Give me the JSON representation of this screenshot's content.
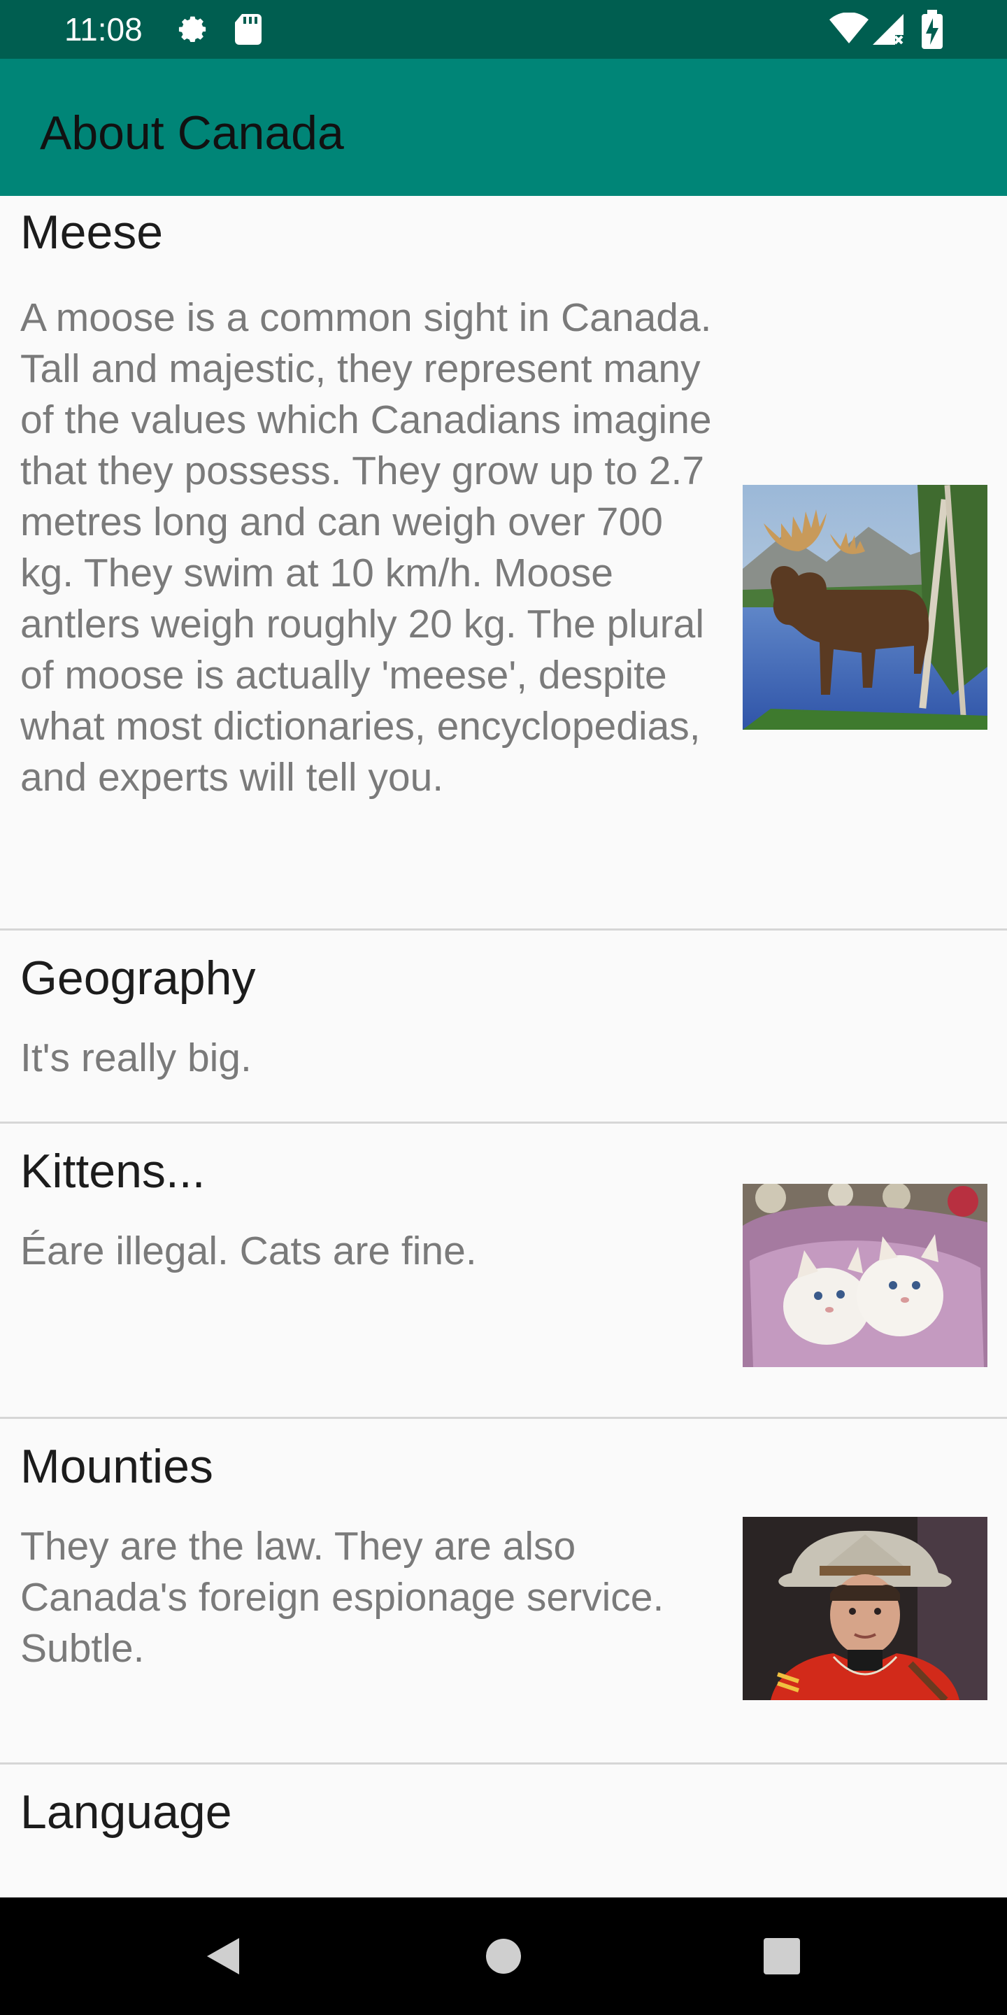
{
  "status_bar": {
    "time": "11:08",
    "left_icons": [
      "gear-icon",
      "sd-card-icon"
    ],
    "right_icons": [
      "wifi-icon",
      "cell-signal-icon",
      "battery-charging-icon"
    ],
    "background": "#005e50"
  },
  "app_bar": {
    "title": "About Canada",
    "background": "#008577"
  },
  "items": [
    {
      "title": "Meese",
      "body": "A moose is a common sight in Canada. Tall and majestic, they represent many of the values which Canadians imagine that they possess. They grow up to 2.7 metres long and can weigh over 700 kg. They swim at 10 km/h. Moose antlers weigh roughly 20 kg. The plural of moose is actually 'meese', despite what most dictionaries, encyclopedias, and experts will tell you.",
      "image": "moose-photo"
    },
    {
      "title": "Geography",
      "body": "It's really big."
    },
    {
      "title": "Kittens...",
      "body": "Éare illegal. Cats are fine.",
      "image": "kittens-photo"
    },
    {
      "title": "Mounties",
      "body": "They are the law. They are also Canada's foreign espionage service. Subtle.",
      "image": "mountie-photo"
    },
    {
      "title": "Language",
      "body": ""
    }
  ],
  "nav_bar": {
    "buttons": [
      "back-icon",
      "home-icon",
      "recents-icon"
    ]
  }
}
